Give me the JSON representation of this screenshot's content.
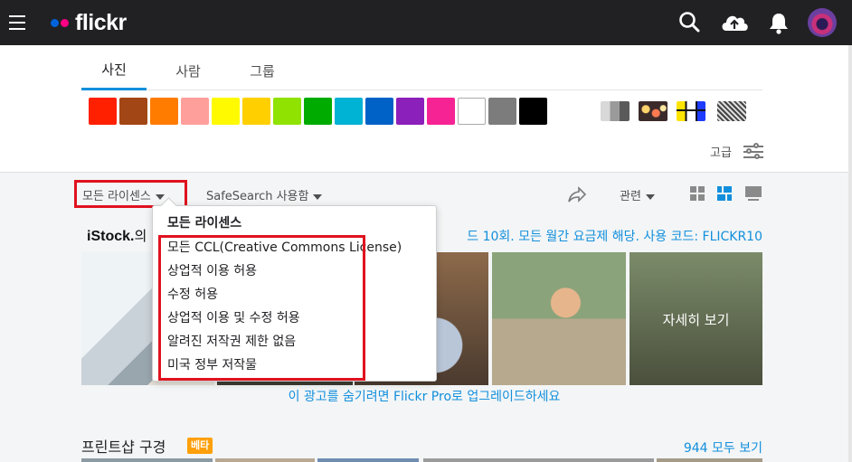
{
  "header": {
    "logo_text": "flickr",
    "logo_dot_colors": [
      "#0063dc",
      "#ff0084"
    ],
    "icons": [
      "menu-icon",
      "search-icon",
      "upload-cloud-icon",
      "notification-bell-icon",
      "avatar"
    ]
  },
  "tabs": [
    {
      "label": "사진",
      "active": true
    },
    {
      "label": "사람",
      "active": false
    },
    {
      "label": "그룹",
      "active": false
    }
  ],
  "colors": [
    "#ff2000",
    "#a24615",
    "#ff7c00",
    "#ff9f9c",
    "#fffa00",
    "#ffcf00",
    "#90e200",
    "#00ab00",
    "#00b2d4",
    "#0062c6",
    "#8c20ba",
    "#f52394",
    "#ffffff",
    "#7c7c7c",
    "#000000"
  ],
  "style_filters": [
    "black-and-white",
    "shallow-depth-of-field",
    "minimalist",
    "patterns"
  ],
  "advanced_label": "고급",
  "filters": {
    "license": "모든 라이센스",
    "safesearch": "SafeSearch 사용함",
    "sort": "관련"
  },
  "ad": {
    "brand": "iStock.",
    "brand_suffix": "의",
    "text": "드 10회. 모든 월간 요금제 해당. 사용 코드: FLICKR10",
    "see_more": "자세히 보기",
    "upgrade": "이 광고를 숨기려면 Flickr Pro로 업그레이드하세요"
  },
  "printshop": {
    "title": "프린트샵 구경",
    "badge": "베타",
    "see_all": "944 모두 보기"
  },
  "license_menu": {
    "heading": "모든 라이센스",
    "items": [
      "모든 CCL(Creative Commons License)",
      "상업적 이용 허용",
      "수정 허용",
      "상업적 이용 및 수정 허용",
      "알려진 저작권 제한 없음",
      "미국 정부 저작물"
    ]
  },
  "annotation_color": "#e0121f",
  "accent_color": "#128fdc"
}
